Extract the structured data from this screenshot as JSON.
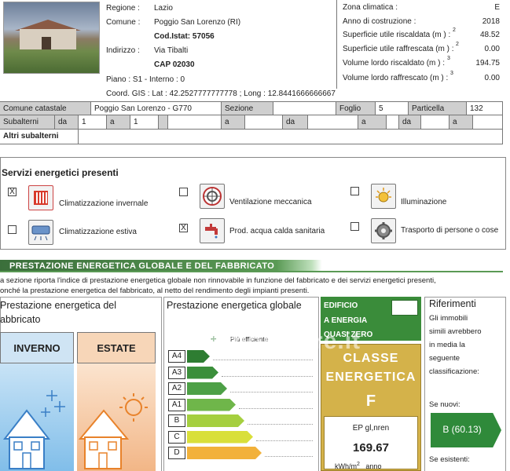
{
  "header": {
    "regione_label": "Regione :",
    "regione_value": "Lazio",
    "comune_label": "Comune :",
    "comune_value": "Poggio San Lorenzo (RI)",
    "cod_istat": "Cod.Istat: 57056",
    "indirizzo_label": "Indirizzo :",
    "indirizzo_value": "Via Tibalti",
    "cap": "CAP 02030",
    "piano": "Piano : S1 - Interno : 0",
    "coord": "Coord. GIS : Lat : 42.2527777777778 ; Long : 12.8441666666667"
  },
  "right_info": [
    {
      "label": "Zona climatica :",
      "value": "E",
      "sup": ""
    },
    {
      "label": "Anno di costruzione :",
      "value": "2018",
      "sup": ""
    },
    {
      "label": "Superficie utile riscaldata (m ) :",
      "value": "48.52",
      "sup": "2"
    },
    {
      "label": "Superficie utile raffrescata (m ) :",
      "value": "0.00",
      "sup": "2"
    },
    {
      "label": "Volume lordo riscaldato (m ) :",
      "value": "194.75",
      "sup": "3"
    },
    {
      "label": "Volume lordo raffrescato (m ) :",
      "value": "0.00",
      "sup": "3"
    }
  ],
  "cadastral": {
    "comune_catastale_label": "Comune catastale",
    "comune_catastale_value": "Poggio San Lorenzo - G770",
    "sezione_label": "Sezione",
    "foglio_label": "Foglio",
    "foglio_value": "5",
    "particella_label": "Particella",
    "particella_value": "132",
    "subalterni_label": "Subalterni",
    "da": "da",
    "a": "a",
    "sub_da_value": "1",
    "sub_a_value": "1",
    "altri_label": "Altri subalterni"
  },
  "services": {
    "title": "Servizi energetici presenti",
    "items": [
      {
        "label": "Climatizzazione invernale",
        "checked": "X"
      },
      {
        "label": "Ventilazione meccanica",
        "checked": ""
      },
      {
        "label": "Illuminazione",
        "checked": ""
      },
      {
        "label": "Climatizzazione estiva",
        "checked": ""
      },
      {
        "label": "Prod. acqua calda sanitaria",
        "checked": "X"
      },
      {
        "label": "Trasporto di persone o cose",
        "checked": ""
      }
    ]
  },
  "banner": {
    "title": "PRESTAZIONE ENERGETICA GLOBALE  E DEL FABBRICATO",
    "desc_line1": "a sezione riporta l'indice di prestazione energetica globale non rinnovabile in funzione del fabbricato e dei servizi energetici presenti,",
    "desc_line2": "onché la prestazione energetica del fabbricato, al netto del rendimento degli impianti presenti."
  },
  "fabbricato": {
    "title_line1": "Prestazione energetica del",
    "title_line2": "abbricato",
    "inverno": "INVERNO",
    "estate": "ESTATE"
  },
  "globale": {
    "title": "Prestazione energetica globale",
    "piu_efficiente": "Più efficiente",
    "classes": [
      "A4",
      "A3",
      "A2",
      "A1",
      "B",
      "C",
      "D"
    ]
  },
  "nzeb": {
    "line1": "EDIFICIO",
    "line2": "A ENERGIA",
    "line3": "QUASI ZERO"
  },
  "classe": {
    "line1": "CLASSE",
    "line2": "ENERGETICA",
    "letter": "F",
    "ep_label": "EP gl,nren",
    "ep_value": "169.67",
    "unit": "kWh/m",
    "unit_sup": "2",
    "unit_tail": "anno"
  },
  "riferimenti": {
    "title": "Riferimenti",
    "text_lines": [
      "Gli immobili",
      "simili avrebbero",
      "in media la",
      "seguente",
      "classificazione:"
    ],
    "se_nuovi": "Se nuovi:",
    "nuovi_value": "B (60.13)",
    "se_esistenti": "Se esistenti:"
  },
  "watermark": "immobiliare.it",
  "colors": {
    "green_dark": "#2f7a36",
    "green": "#5a9a55",
    "classe_bg": "#d4b24a",
    "nzeb_green": "#3a8c3a"
  },
  "chart_data": {
    "type": "bar",
    "categories": [
      "A4",
      "A3",
      "A2",
      "A1",
      "B",
      "C",
      "D"
    ],
    "values": [
      1,
      2,
      3,
      4,
      5,
      6,
      7
    ]
  }
}
